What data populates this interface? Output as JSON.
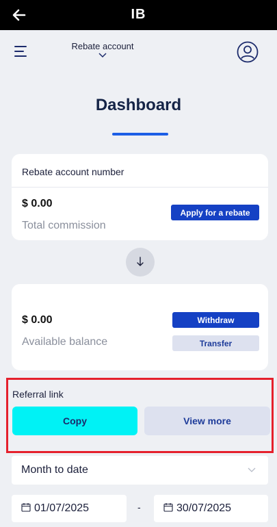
{
  "topbar": {
    "title": "IB",
    "back_icon": "arrow-left-icon"
  },
  "header": {
    "account_label": "Rebate account",
    "menu_icon": "hamburger-menu-icon",
    "avatar_icon": "user-avatar-icon"
  },
  "page": {
    "title": "Dashboard"
  },
  "rebate_card": {
    "title": "Rebate account number",
    "amount": "$ 0.00",
    "amount_label": "Total commission",
    "apply_button": "Apply for a rebate"
  },
  "balance_card": {
    "amount": "$ 0.00",
    "amount_label": "Available balance",
    "withdraw_button": "Withdraw",
    "transfer_button": "Transfer"
  },
  "referral": {
    "title": "Referral link",
    "copy_button": "Copy",
    "view_more_button": "View more"
  },
  "filters": {
    "period": "Month to date",
    "date_from": "01/07/2025",
    "date_to": "30/07/2025",
    "separator": "-"
  },
  "colors": {
    "primary": "#1541c4",
    "accent_underline": "#1c5ee6",
    "copy_button": "#00f2f5",
    "highlight_border": "#e5202c"
  }
}
